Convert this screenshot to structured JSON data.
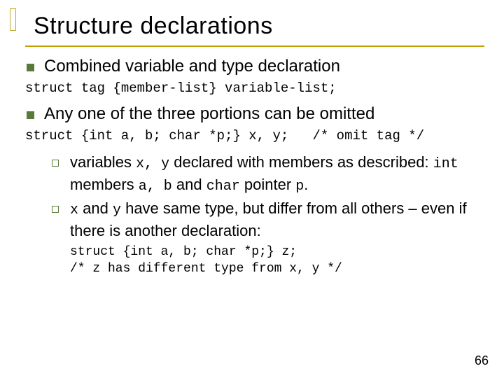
{
  "title": "Structure declarations",
  "bullets": {
    "b1": "Combined variable and type declaration",
    "b2": "Any one of the three portions can be omitted"
  },
  "code": {
    "c1": "struct tag {member-list} variable-list;",
    "c2": "struct {int a, b; char *p;} x, y;   /* omit tag */",
    "c3": "struct {int a, b; char *p;} z;\n/* z has different type from x, y */"
  },
  "sub": {
    "s1_a": "variables ",
    "s1_b": "x, y",
    "s1_c": " declared with members as described: ",
    "s1_d": "int",
    "s1_e": " members ",
    "s1_f": "a, b",
    "s1_g": " and ",
    "s1_h": "char",
    "s1_i": " pointer ",
    "s1_j": "p",
    "s1_k": ".",
    "s2_a": "x",
    "s2_b": " and ",
    "s2_c": "y",
    "s2_d": " have same type, but differ from all others – even if there is another declaration:"
  },
  "page": "66"
}
